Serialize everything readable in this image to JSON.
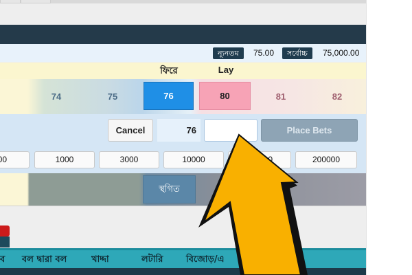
{
  "limits": {
    "min_label": "ন্যূনতম",
    "min_value": "75.00",
    "max_label": "সর্বোচ্চ",
    "max_value": "75,000.00"
  },
  "headers": {
    "back_label": "ফিরে",
    "lay_label": "Lay"
  },
  "odds": {
    "back": [
      "74",
      "75",
      "76"
    ],
    "lay": [
      "80",
      "81",
      "82"
    ]
  },
  "bet_slip": {
    "cancel_label": "Cancel",
    "odds_value": "76",
    "stake_value": "",
    "place_label": "Place Bets"
  },
  "stakes": [
    "00",
    "1000",
    "3000",
    "10000",
    "00",
    "200000"
  ],
  "suspended": {
    "label": "স্থগিত"
  },
  "category_nav": {
    "items": [
      "ব",
      "বল দ্বারা বল",
      "খাদ্দা",
      "লটারি",
      "বিজোড়/এ"
    ]
  },
  "colors": {
    "back_selected": "#1f8fe6",
    "lay_selected": "#f7a3b6",
    "header_dark": "#243a4a",
    "nav_teal": "#2ea8b8",
    "arrow": "#f9b000"
  },
  "icons": {
    "pointer": "arrow-pointer-icon"
  }
}
